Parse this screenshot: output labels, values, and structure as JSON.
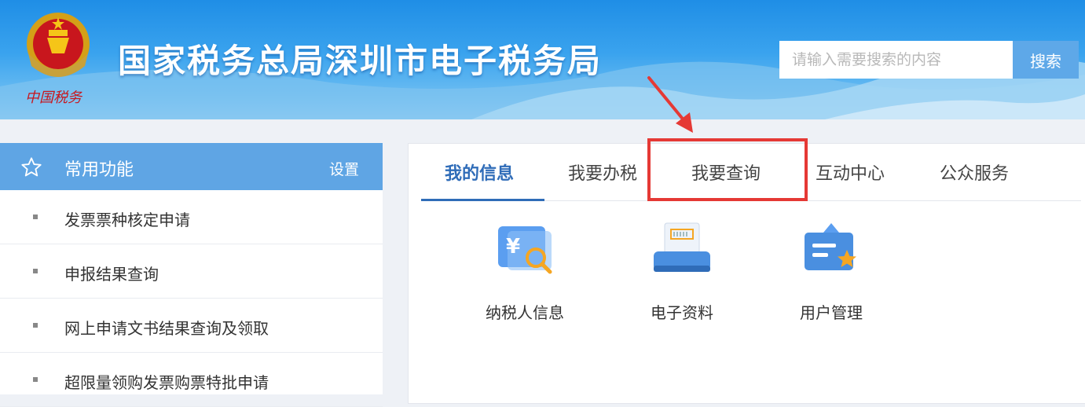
{
  "header": {
    "site_title": "国家税务总局深圳市电子税务局",
    "emblem_caption": "中国税务",
    "search_placeholder": "请输入需要搜索的内容",
    "search_button": "搜索"
  },
  "sidebar": {
    "title": "常用功能",
    "setting_label": "设置",
    "items": [
      {
        "label": "发票票种核定申请"
      },
      {
        "label": "申报结果查询"
      },
      {
        "label": "网上申请文书结果查询及领取"
      },
      {
        "label": "超限量领购发票购票特批申请"
      }
    ]
  },
  "main": {
    "tabs": [
      {
        "label": "我的信息",
        "active": true
      },
      {
        "label": "我要办税"
      },
      {
        "label": "我要查询",
        "highlighted": true
      },
      {
        "label": "互动中心"
      },
      {
        "label": "公众服务"
      }
    ],
    "tiles": [
      {
        "label": "纳税人信息",
        "icon": "taxpayer-info-icon"
      },
      {
        "label": "电子资料",
        "icon": "electronic-document-icon"
      },
      {
        "label": "用户管理",
        "icon": "user-management-icon"
      }
    ]
  },
  "colors": {
    "accent": "#2f6cb8",
    "sidebar_header": "#5fa5e4",
    "highlight": "#e53935"
  }
}
